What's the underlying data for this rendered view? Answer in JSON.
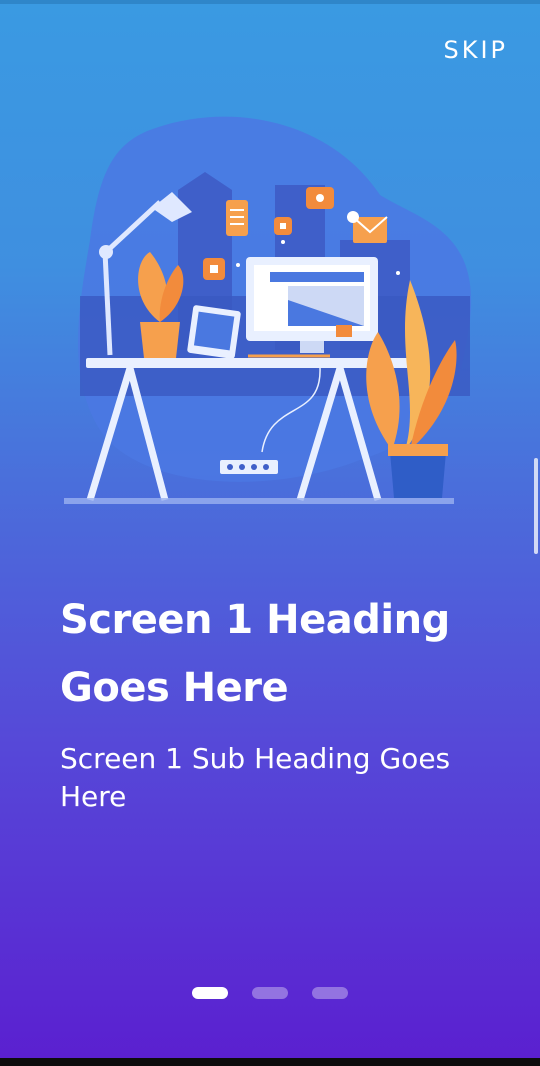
{
  "header": {
    "skip_label": "SKIP"
  },
  "content": {
    "heading": "Screen 1 Heading Goes Here",
    "subheading": "Screen 1 Sub Heading Goes Here"
  },
  "pagination": {
    "total": 3,
    "active_index": 0
  },
  "colors": {
    "gradient_top": "#3a9ae2",
    "gradient_bottom": "#5b1fd0",
    "accent_orange": "#f28b3c",
    "text": "#ffffff"
  }
}
